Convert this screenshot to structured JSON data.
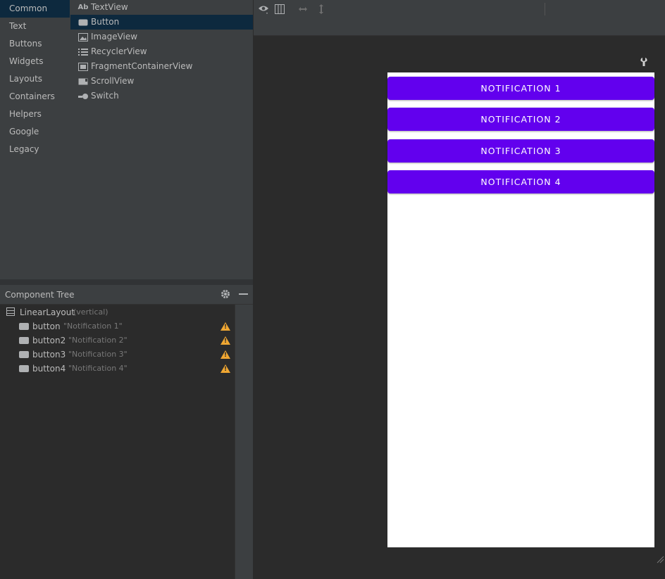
{
  "palette": {
    "categories": [
      "Common",
      "Text",
      "Buttons",
      "Widgets",
      "Layouts",
      "Containers",
      "Helpers",
      "Google",
      "Legacy"
    ],
    "selected_category": "Common",
    "widgets": [
      {
        "label": "TextView",
        "icon": "textview-icon",
        "glyph": "Ab"
      },
      {
        "label": "Button",
        "icon": "button-icon"
      },
      {
        "label": "ImageView",
        "icon": "imageview-icon"
      },
      {
        "label": "RecyclerView",
        "icon": "recyclerview-icon"
      },
      {
        "label": "FragmentContainerView",
        "icon": "fragmentcontainer-icon"
      },
      {
        "label": "ScrollView",
        "icon": "scrollview-icon"
      },
      {
        "label": "Switch",
        "icon": "switch-icon"
      }
    ],
    "selected_widget": "Button"
  },
  "component_tree": {
    "title": "Component Tree",
    "root": {
      "name": "LinearLayout",
      "detail": "(vertical)"
    },
    "children": [
      {
        "name": "button",
        "detail": "\"Notification 1\""
      },
      {
        "name": "button2",
        "detail": "\"Notification 2\""
      },
      {
        "name": "button3",
        "detail": "\"Notification 3\""
      },
      {
        "name": "button4",
        "detail": "\"Notification 4\""
      }
    ],
    "warning_symbol": "!"
  },
  "design": {
    "buttons": [
      "NOTIFICATION 1",
      "NOTIFICATION 2",
      "NOTIFICATION 3",
      "NOTIFICATION 4"
    ],
    "button_color": "#6200ee"
  },
  "colors": {
    "panel_bg": "#3c3f41",
    "editor_bg": "#2b2b2b",
    "selection": "#0d293e",
    "warning": "#f0a732"
  }
}
